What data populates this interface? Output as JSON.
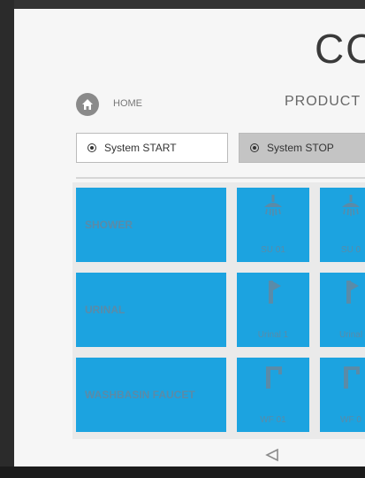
{
  "header": {
    "logo_text": "CO",
    "home_label": "HOME",
    "product_label": "PRODUCT"
  },
  "controls": {
    "start_label": "System START",
    "stop_label": "System STOP"
  },
  "categories": [
    {
      "label": "SHOWER",
      "tiles": [
        {
          "label": "SU 01",
          "icon": "shower-icon"
        },
        {
          "label": "SU 0",
          "icon": "shower-icon"
        }
      ]
    },
    {
      "label": "URINAL",
      "tiles": [
        {
          "label": "Urinal 1",
          "icon": "urinal-flush-icon"
        },
        {
          "label": "Urinal",
          "icon": "urinal-flush-icon"
        }
      ]
    },
    {
      "label": "WASHBASIN FAUCET",
      "tiles": [
        {
          "label": "WF 01",
          "icon": "faucet-icon"
        },
        {
          "label": "WF 0",
          "icon": "faucet-icon"
        }
      ]
    }
  ],
  "nav": {
    "back_icon": "back-icon"
  },
  "colors": {
    "tile": "#1ca3e0",
    "tile_text": "#5a8ba8",
    "stop_button": "#c4c4c4"
  }
}
